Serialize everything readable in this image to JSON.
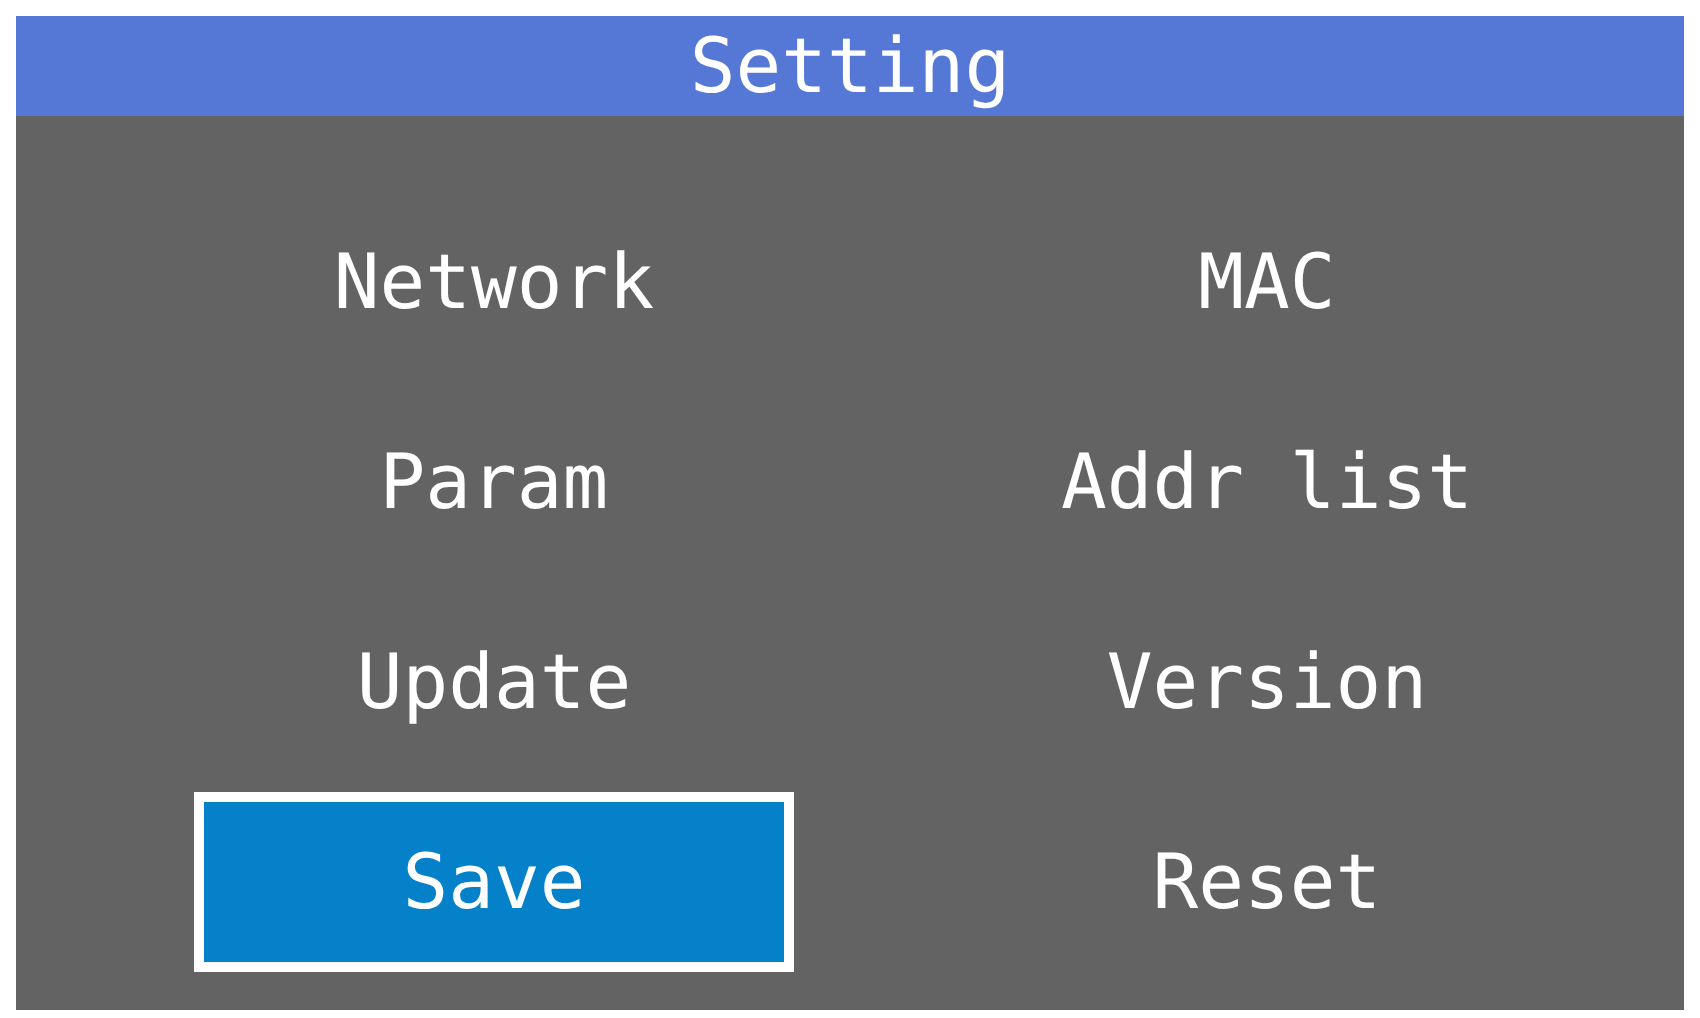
{
  "window": {
    "title": "Setting"
  },
  "menu_items": [
    {
      "label": "Network",
      "selected": false
    },
    {
      "label": "MAC",
      "selected": false
    },
    {
      "label": "Param",
      "selected": false
    },
    {
      "label": "Addr list",
      "selected": false
    },
    {
      "label": "Update",
      "selected": false
    },
    {
      "label": "Version",
      "selected": false
    },
    {
      "label": "Save",
      "selected": true
    },
    {
      "label": "Reset",
      "selected": false
    }
  ]
}
